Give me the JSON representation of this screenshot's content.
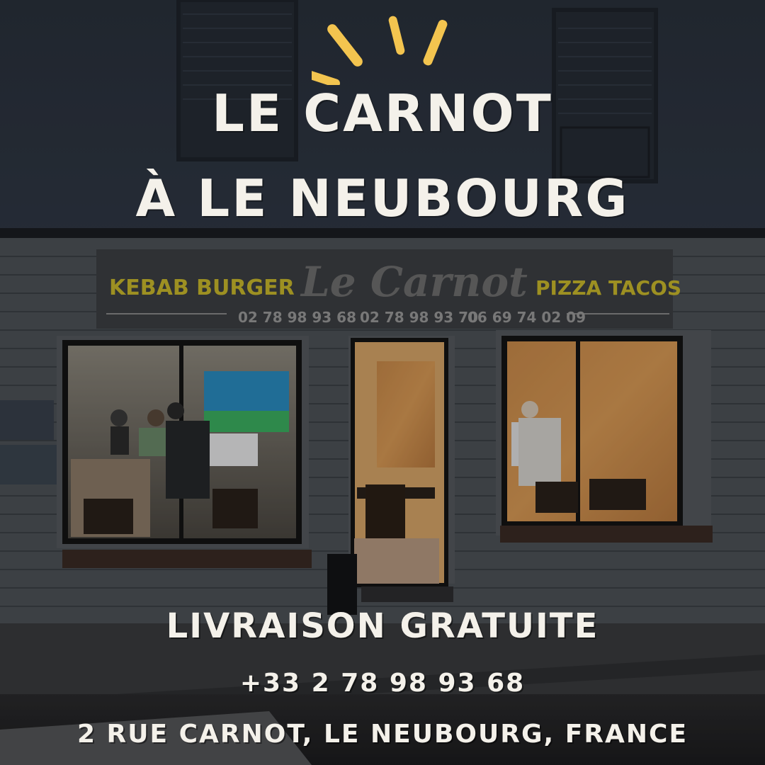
{
  "headline": {
    "line1": "LE CARNOT",
    "line2": "À LE NEUBOURG"
  },
  "storefront_sign": {
    "left_text": "KEBAB BURGER",
    "brand": "Le Carnot",
    "right_text": "PIZZA TACOS",
    "phones": [
      "02 78 98 93 68",
      "02 78 98 93 70",
      "06 69 74 02 09"
    ]
  },
  "footer": {
    "delivery": "LIVRAISON GRATUITE",
    "phone": "+33 2 78 98 93 68",
    "address": "2 RUE CARNOT, LE NEUBOURG, FRANCE"
  },
  "colors": {
    "accent_rays": "#f3c44f",
    "text": "#f4f1ea",
    "sign_yellow": "#c9b92c",
    "facade_upper": "#2c3440",
    "facade_lower": "#4a4f55"
  }
}
